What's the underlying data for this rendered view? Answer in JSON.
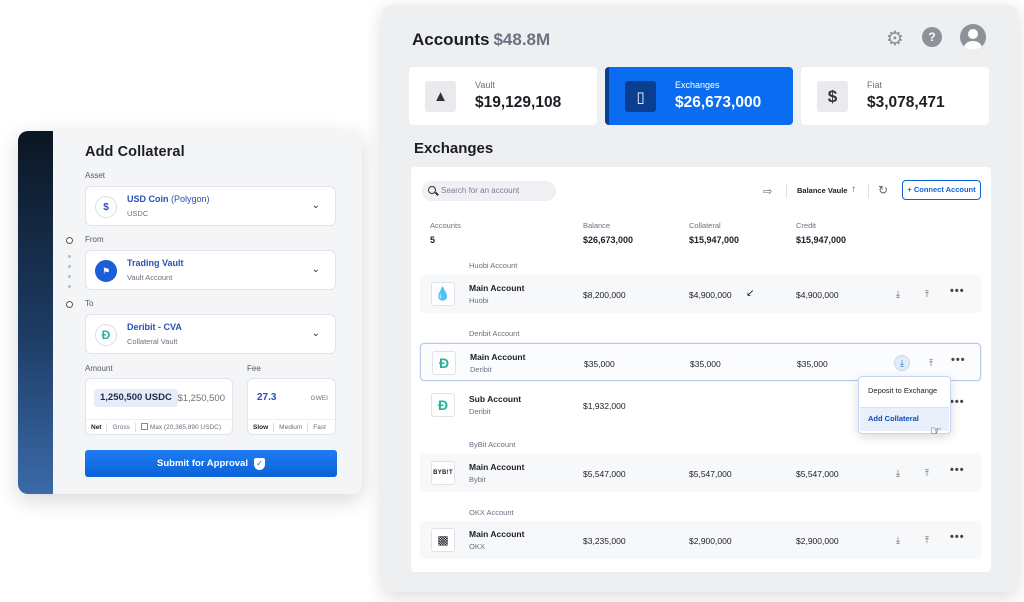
{
  "collateral_panel": {
    "title": "Add Collateral",
    "asset": {
      "label": "Asset",
      "name": "USD Coin",
      "network": "(Polygon)",
      "sub": "USDC",
      "icon": "usdc-icon"
    },
    "from": {
      "label": "From",
      "name": "Trading Vault",
      "sub": "Vault Account",
      "icon": "vault-shield-icon"
    },
    "to": {
      "label": "To",
      "name": "Deribit - CVA",
      "sub": "Collateral Vault",
      "icon": "deribit-icon"
    },
    "amount": {
      "label": "Amount",
      "value": "1,250,500 USDC",
      "alt": "$1,250,500",
      "net": "Net",
      "gross": "Gross",
      "max": "Max (20,365,890 USDC)"
    },
    "fee": {
      "label": "Fee",
      "value": "27.3",
      "unit": "GWEI",
      "slow": "Slow",
      "medium": "Medium",
      "fast": "Fast"
    },
    "submit_label": "Submit for Approval"
  },
  "main": {
    "title": "Accounts",
    "total": "$48.8M",
    "cards": [
      {
        "label": "Vault",
        "value": "$19,129,108",
        "icon": "vault-icon"
      },
      {
        "label": "Exchanges",
        "value": "$26,673,000",
        "icon": "candlestick-icon"
      },
      {
        "label": "Fiat",
        "value": "$3,078,471",
        "icon": "dollar-icon"
      }
    ],
    "section_title": "Exchanges",
    "search_placeholder": "Search for an account",
    "sort_label": "Balance Vaule",
    "connect_label": "+ Connect Account",
    "header": {
      "accounts_label": "Accounts",
      "accounts_value": "5",
      "balance_label": "Balance",
      "balance_value": "$26,673,000",
      "collateral_label": "Collateral",
      "collateral_value": "$15,947,000",
      "credit_label": "Credit",
      "credit_value": "$15,947,000"
    },
    "groups": {
      "huobi": "Huobi Account",
      "deribit": "Deribit Account",
      "bybit": "ByBit Account",
      "okx": "OKX Account"
    },
    "rows": [
      {
        "name": "Main Account",
        "exchange": "Huobi",
        "balance": "$8,200,000",
        "collateral": "$4,900,000",
        "credit": "$4,900,000",
        "logo": "huobi-logo"
      },
      {
        "name": "Main Account",
        "exchange": "Deribit",
        "balance": "$35,000",
        "collateral": "$35,000",
        "credit": "$35,000",
        "logo": "deribit-logo"
      },
      {
        "name": "Sub Account",
        "exchange": "Deribit",
        "balance": "$1,932,000",
        "collateral": "",
        "credit": "",
        "logo": "deribit-logo"
      },
      {
        "name": "Main Account",
        "exchange": "Bybit",
        "balance": "$5,547,000",
        "collateral": "$5,547,000",
        "credit": "$5,547,000",
        "logo": "bybit-logo"
      },
      {
        "name": "Main Account",
        "exchange": "OKX",
        "balance": "$3,235,000",
        "collateral": "$2,900,000",
        "credit": "$2,900,000",
        "logo": "okx-logo"
      }
    ],
    "menu": {
      "item1": "Deposit to Exchange",
      "item2": "Add Collateral"
    },
    "colors": {
      "accent": "#0a6cf0",
      "deribit": "#25b39a",
      "huobi": "#1a5fd6"
    }
  }
}
